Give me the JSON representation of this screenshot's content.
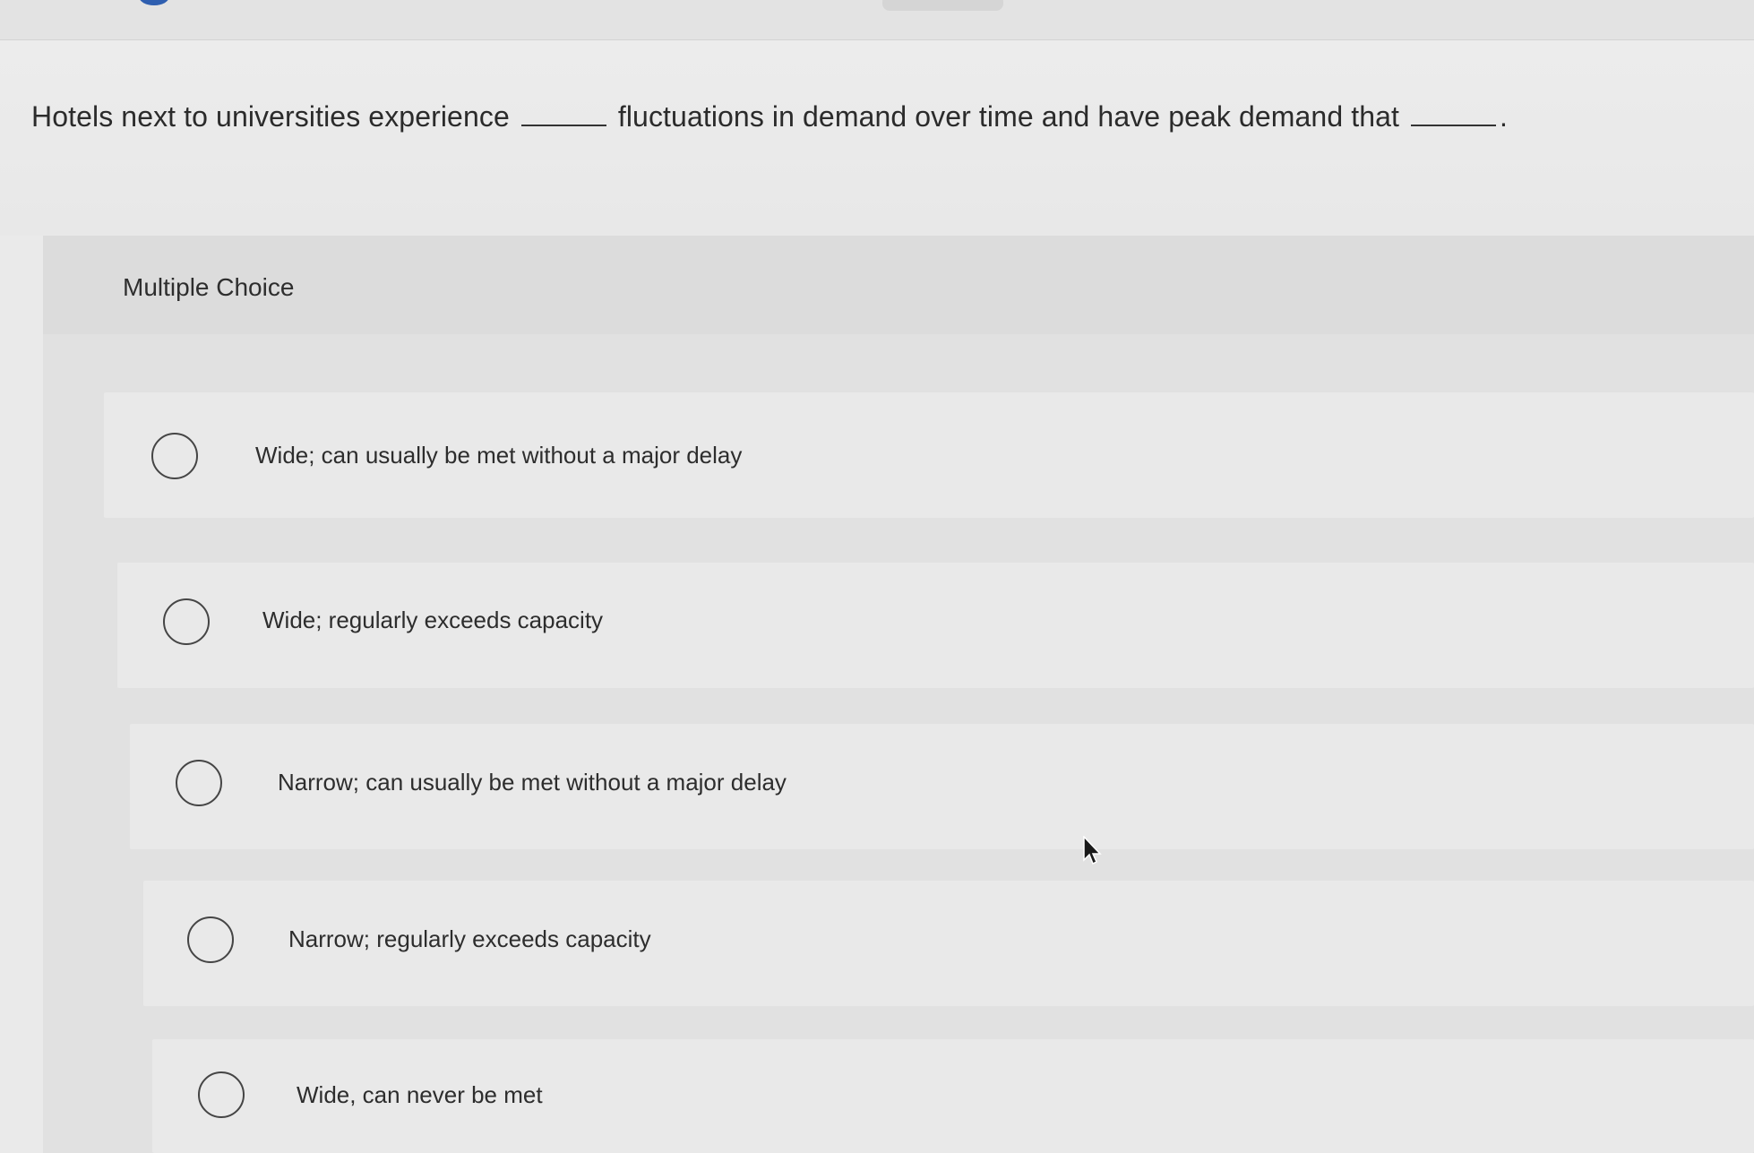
{
  "question": {
    "part1": "Hotels next to universities experience",
    "part2": "fluctuations in demand over time and have peak demand that",
    "part3": "."
  },
  "section": {
    "title": "Multiple Choice"
  },
  "options": [
    {
      "label": "Wide; can usually be met without a major delay",
      "selected": false
    },
    {
      "label": "Wide; regularly exceeds capacity",
      "selected": false
    },
    {
      "label": "Narrow; can usually be met without a major delay",
      "selected": false
    },
    {
      "label": "Narrow; regularly exceeds capacity",
      "selected": false
    },
    {
      "label": "Wide, can never be met",
      "selected": false
    }
  ],
  "colors": {
    "page_background": "#eaeaea",
    "panel_background": "#e1e1e1",
    "option_background": "#e9e9e9",
    "radio_border": "#454545",
    "accent_blue": "#2f5fb0"
  },
  "icons": {
    "radio": "radio-unselected-icon",
    "cursor": "mouse-pointer-icon"
  }
}
